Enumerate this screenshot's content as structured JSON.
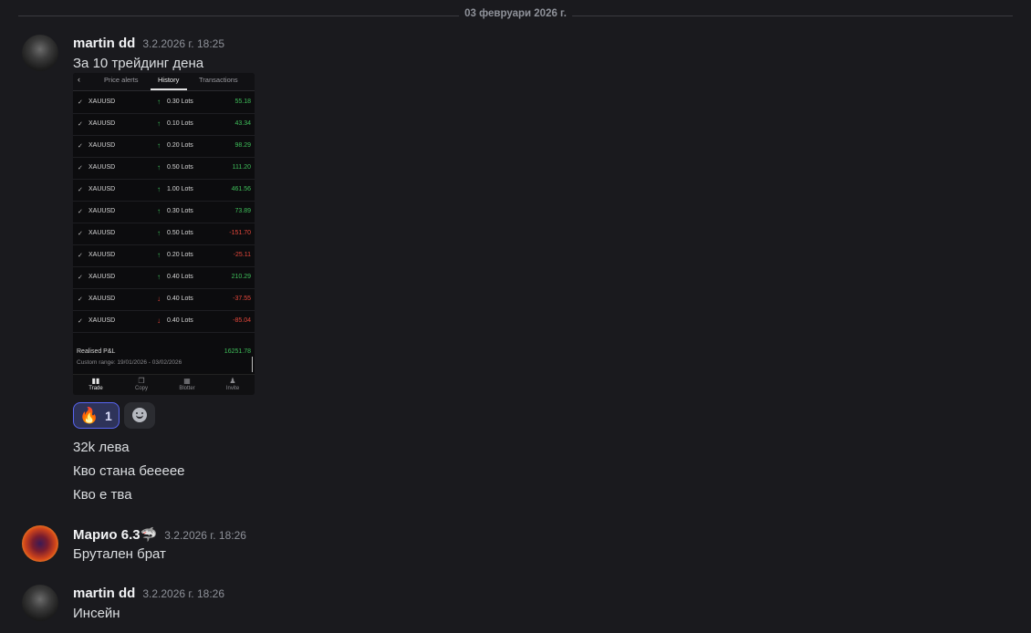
{
  "date_divider": "03 февруари 2026 г.",
  "messages": [
    {
      "author": "martin dd",
      "timestamp": "3.2.2026 г. 18:25",
      "text": "За 10 трейдинг дена"
    },
    {
      "author": "Марио 6.3🦈",
      "timestamp": "3.2.2026 г. 18:26",
      "text": "Брутален брат"
    },
    {
      "author": "martin dd",
      "timestamp": "3.2.2026 г. 18:26",
      "text": "Инсейн"
    }
  ],
  "followups": [
    "32k лева",
    "Кво стана беееее",
    "Кво е тва"
  ],
  "reaction": {
    "emoji": "🔥",
    "count": "1"
  },
  "attachment": {
    "tabs": [
      "Price alerts",
      "History",
      "Transactions"
    ],
    "rows": [
      {
        "symbol": "XAUUSD",
        "dir": "up",
        "lots": "0.30 Lots",
        "pnl": "55.18"
      },
      {
        "symbol": "XAUUSD",
        "dir": "up",
        "lots": "0.10 Lots",
        "pnl": "43.34"
      },
      {
        "symbol": "XAUUSD",
        "dir": "up",
        "lots": "0.20 Lots",
        "pnl": "98.29"
      },
      {
        "symbol": "XAUUSD",
        "dir": "up",
        "lots": "0.50 Lots",
        "pnl": "111.20"
      },
      {
        "symbol": "XAUUSD",
        "dir": "up",
        "lots": "1.00 Lots",
        "pnl": "461.56"
      },
      {
        "symbol": "XAUUSD",
        "dir": "up",
        "lots": "0.30 Lots",
        "pnl": "73.89"
      },
      {
        "symbol": "XAUUSD",
        "dir": "up",
        "lots": "0.50 Lots",
        "pnl": "-151.70"
      },
      {
        "symbol": "XAUUSD",
        "dir": "up",
        "lots": "0.20 Lots",
        "pnl": "-25.11"
      },
      {
        "symbol": "XAUUSD",
        "dir": "up",
        "lots": "0.40 Lots",
        "pnl": "210.29"
      },
      {
        "symbol": "XAUUSD",
        "dir": "down",
        "lots": "0.40 Lots",
        "pnl": "-37.55"
      },
      {
        "symbol": "XAUUSD",
        "dir": "down",
        "lots": "0.40 Lots",
        "pnl": "-85.04"
      }
    ],
    "realised_label": "Realised P&L",
    "realised_value": "16251.78",
    "range": "Custom range: 19/01/2026 - 03/02/2026",
    "nav": [
      "Trade",
      "Copy",
      "Blotter",
      "Invite"
    ]
  }
}
